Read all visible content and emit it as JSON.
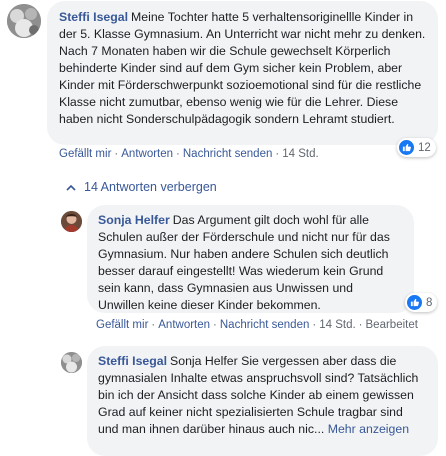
{
  "comment1": {
    "author": "Steffi Isegal",
    "text": "Meine Tochter hatte 5 verhaltensoriginellle Kinder in der 5. Klasse Gymnasium. An Unterricht war nicht mehr zu denken. Nach 7 Monaten haben wir die Schule gewechselt Körperlich behinderte Kinder sind auf dem Gym sicher kein Problem, aber Kinder mit Förderschwerpunkt sozioemotional sind für die restliche Klasse nicht zumutbar, ebenso wenig wie für die Lehrer. Diese haben nicht Sonderschulpädagogik sondern Lehramt studiert.",
    "actions": {
      "like": "Gefällt mir",
      "reply": "Antworten",
      "send": "Nachricht senden",
      "time": "14 Std."
    },
    "reaction_count": "12"
  },
  "replies_toggle": {
    "label": "14 Antworten verbergen"
  },
  "comment2": {
    "author": "Sonja Helfer",
    "text": "Das Argument gilt doch wohl für alle Schulen außer der Förderschule und nicht nur für das Gymnasium. Nur haben andere Schulen sich deutlich besser darauf eingestellt! Was wiederum kein Grund sein kann, dass Gymnasien aus Unwissen und Unwillen keine dieser Kinder bekommen.",
    "actions": {
      "like": "Gefällt mir",
      "reply": "Antworten",
      "send": "Nachricht senden",
      "time": "14 Std.",
      "edited": "Bearbeitet"
    },
    "reaction_count": "8"
  },
  "comment3": {
    "author": "Steffi Isegal",
    "text": "Sonja Helfer Sie vergessen aber dass die gymnasialen Inhalte etwas anspruchsvoll sind? Tatsächlich bin ich der Ansicht dass solche Kinder ab einem gewissen Grad auf keiner nicht spezialisierten Schule tragbar sind und man ihnen darüber hinaus auch nic...",
    "more_label": "Mehr anzeigen"
  },
  "colors": {
    "link": "#385898",
    "bubble": "#f2f3f5",
    "like_blue": "#1877f2",
    "meta": "#606770"
  },
  "icons": {
    "like": "thumbs-up-icon",
    "toggle": "chevron-up-icon"
  }
}
